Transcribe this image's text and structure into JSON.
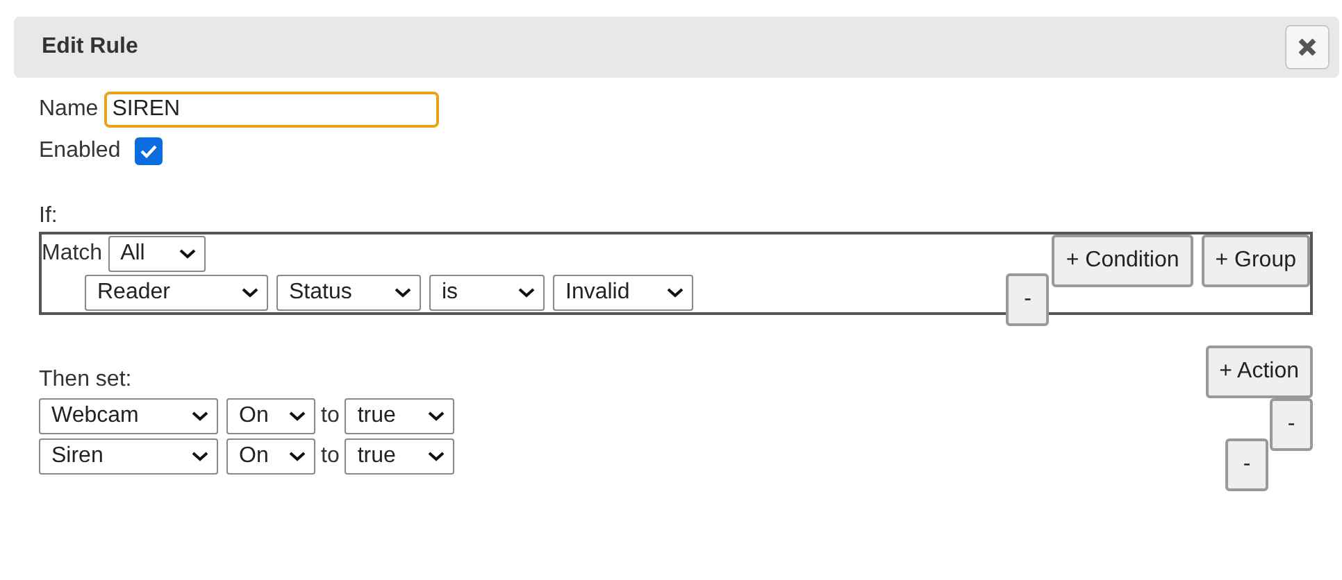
{
  "dialog": {
    "title": "Edit Rule"
  },
  "name_field": {
    "label": "Name",
    "value": "SIREN",
    "focused": true
  },
  "enabled": {
    "label": "Enabled",
    "checked": true
  },
  "if": {
    "label": "If:",
    "match": {
      "label": "Match",
      "value": "All"
    },
    "conditions": [
      {
        "fields": [
          "Reader",
          "Status",
          "is",
          "Invalid"
        ],
        "remove_button": "-"
      }
    ],
    "buttons": [
      "+ Condition",
      "+ Group"
    ]
  },
  "then": {
    "label": "Then set:",
    "add_button": "+ Action",
    "actions": [
      {
        "target": "Webcam",
        "property": "On",
        "connector": "to",
        "value": "true",
        "remove_button": "-"
      },
      {
        "target": "Siren",
        "property": "On",
        "connector": "to",
        "value": "true",
        "remove_button": "-"
      }
    ]
  }
}
